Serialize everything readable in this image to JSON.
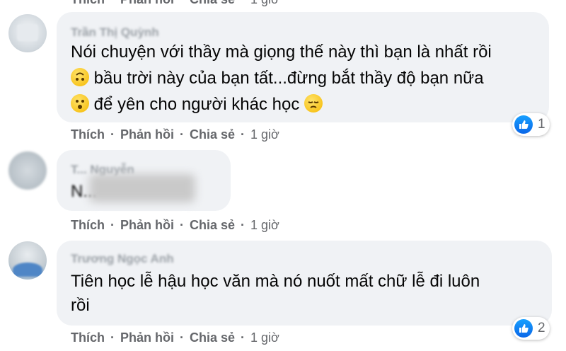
{
  "actions": {
    "like": "Thích",
    "reply": "Phản hồi",
    "share": "Chia sẻ",
    "sep": "·"
  },
  "top_row": {
    "time": "1 giờ"
  },
  "comments": [
    {
      "author": "Trần Thị Quỳnh",
      "lines": [
        "Nói chuyện với thầy mà giọng thế này thì bạn là nhất rồi",
        " bầu trời này của bạn tất...đừng bắt thầy độ bạn nữa",
        " để yên cho người khác học "
      ],
      "time": "1 giờ",
      "reactions": "1"
    },
    {
      "author": "T... Nguyễn",
      "lines": [
        "N..."
      ],
      "time": "1 giờ"
    },
    {
      "author": "Trương Ngọc Anh",
      "lines": [
        "Tiên học lễ hậu học văn mà nó nuốt mất chữ lễ đi luôn",
        "rồi"
      ],
      "time": "1 giờ",
      "reactions": "2"
    }
  ],
  "colors": {
    "bubble": "#f0f2f5",
    "meta": "#65676b",
    "like": "#1877f2"
  }
}
